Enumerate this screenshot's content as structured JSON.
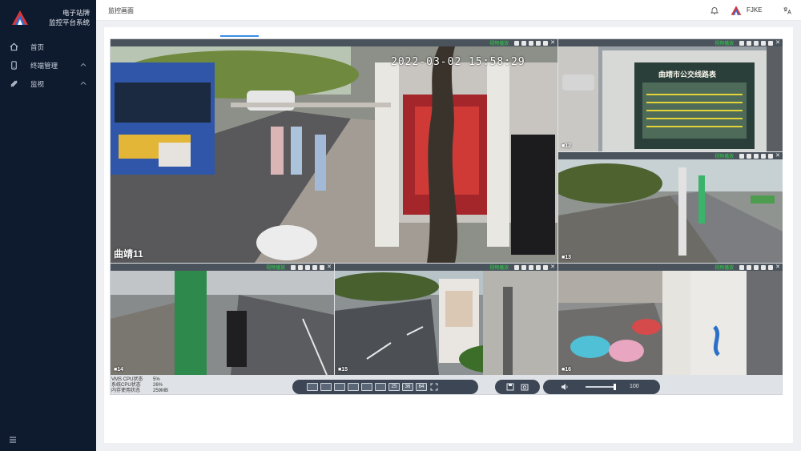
{
  "app": {
    "title_line1": "电子站牌",
    "title_line2": "监控平台系统"
  },
  "sidebar": {
    "items": [
      {
        "label": "首页",
        "icon": "home-icon"
      },
      {
        "label": "终端管理",
        "icon": "phone-icon"
      },
      {
        "label": "监视",
        "icon": "monitor-icon"
      }
    ]
  },
  "header": {
    "page_title": "监控画面",
    "user_name": "FJKE"
  },
  "video": {
    "timestamp": "2022-03-02 15:58:29",
    "live_label": "视频播放",
    "tiles": [
      {
        "label": "曲靖11"
      },
      {
        "label": "■12"
      },
      {
        "label": "■13"
      },
      {
        "label": "■14"
      },
      {
        "label": "■15"
      },
      {
        "label": "■16"
      }
    ],
    "sign_text": "曲靖市公交线路表"
  },
  "stats": [
    {
      "key": "VMS CPU状态",
      "value": "5%"
    },
    {
      "key": "系统CPU状态",
      "value": "26%"
    },
    {
      "key": "内存使用状态",
      "value": "259MB"
    }
  ],
  "layout_buttons": [
    "",
    "",
    "",
    "",
    "",
    "",
    "25",
    "36",
    "64"
  ],
  "volume": {
    "value": "100",
    "level": 1.0
  },
  "colors": {
    "sidebar_bg": "#0e1a2e",
    "accent": "#3b8fe0",
    "live_green": "#2fd14a",
    "control_bar": "#3d4654"
  }
}
